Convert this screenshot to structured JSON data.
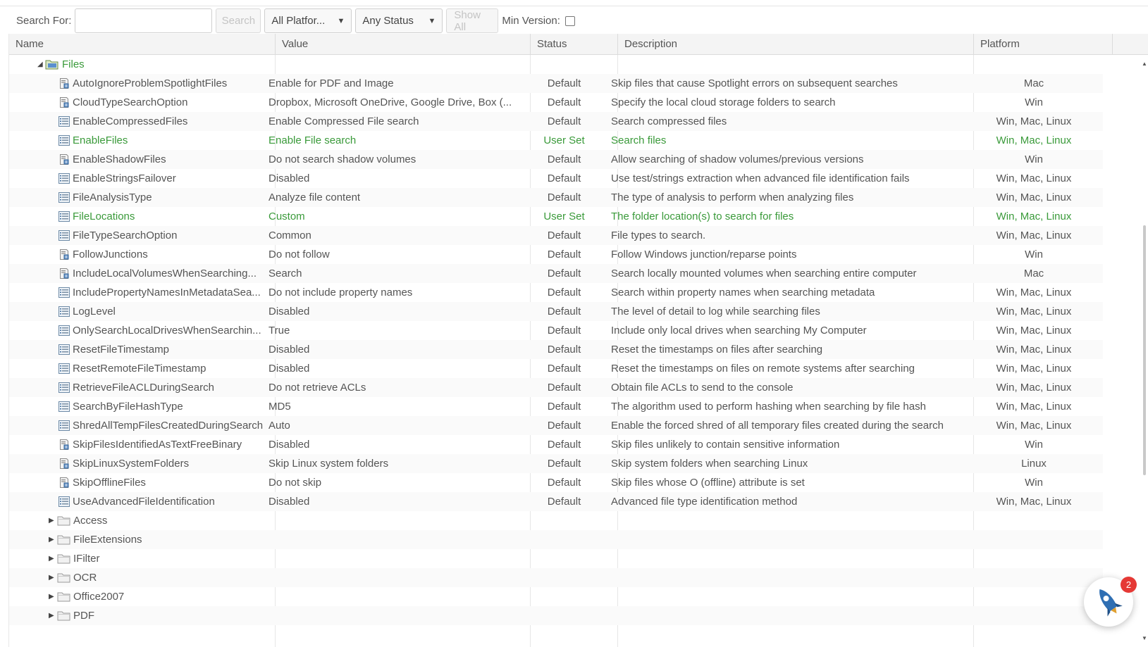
{
  "toolbar": {
    "search_label": "Search For:",
    "search_value": "",
    "search_button": "Search",
    "platform_select": "All Platfor...",
    "status_select": "Any Status",
    "show_all_button": "Show All",
    "min_version_label": "Min Version:"
  },
  "columns": [
    "Name",
    "Value",
    "Status",
    "Description",
    "Platform"
  ],
  "root_folder": "Files",
  "rows": [
    {
      "name": "AutoIgnoreProblemSpotlightFiles",
      "value": "Enable for PDF and Image",
      "status": "Default",
      "description": "Skip files that cause Spotlight errors on subsequent searches",
      "platform": "Mac",
      "icon": "setting-script-icon"
    },
    {
      "name": "CloudTypeSearchOption",
      "value": "Dropbox, Microsoft OneDrive, Google Drive, Box (...",
      "status": "Default",
      "description": "Specify the local cloud storage folders to search",
      "platform": "Win",
      "icon": "setting-script-icon"
    },
    {
      "name": "EnableCompressedFiles",
      "value": "Enable Compressed File search",
      "status": "Default",
      "description": "Search compressed files",
      "platform": "Win, Mac, Linux",
      "icon": "setting-list-icon"
    },
    {
      "name": "EnableFiles",
      "value": "Enable File search",
      "status": "User Set",
      "description": "Search files",
      "platform": "Win, Mac, Linux",
      "icon": "setting-list-icon",
      "user_set": true
    },
    {
      "name": "EnableShadowFiles",
      "value": "Do not search shadow volumes",
      "status": "Default",
      "description": "Allow searching of shadow volumes/previous versions",
      "platform": "Win",
      "icon": "setting-script-icon"
    },
    {
      "name": "EnableStringsFailover",
      "value": "Disabled",
      "status": "Default",
      "description": "Use test/strings extraction when advanced file identification fails",
      "platform": "Win, Mac, Linux",
      "icon": "setting-list-icon"
    },
    {
      "name": "FileAnalysisType",
      "value": "Analyze file content",
      "status": "Default",
      "description": "The type of analysis to perform when analyzing files",
      "platform": "Win, Mac, Linux",
      "icon": "setting-list-icon"
    },
    {
      "name": "FileLocations",
      "value": "Custom",
      "status": "User Set",
      "description": "The folder location(s) to search for files",
      "platform": "Win, Mac, Linux",
      "icon": "setting-list-icon",
      "user_set": true
    },
    {
      "name": "FileTypeSearchOption",
      "value": "Common",
      "status": "Default",
      "description": "File types to search.",
      "platform": "Win, Mac, Linux",
      "icon": "setting-list-icon"
    },
    {
      "name": "FollowJunctions",
      "value": "Do not follow",
      "status": "Default",
      "description": "Follow Windows junction/reparse points",
      "platform": "Win",
      "icon": "setting-script-icon"
    },
    {
      "name": "IncludeLocalVolumesWhenSearching...",
      "value": "Search",
      "status": "Default",
      "description": "Search locally mounted volumes when searching entire computer",
      "platform": "Mac",
      "icon": "setting-script-icon"
    },
    {
      "name": "IncludePropertyNamesInMetadataSea...",
      "value": "Do not include property names",
      "status": "Default",
      "description": "Search within property names when searching metadata",
      "platform": "Win, Mac, Linux",
      "icon": "setting-list-icon"
    },
    {
      "name": "LogLevel",
      "value": "Disabled",
      "status": "Default",
      "description": "The level of detail to log while searching files",
      "platform": "Win, Mac, Linux",
      "icon": "setting-list-icon"
    },
    {
      "name": "OnlySearchLocalDrivesWhenSearchin...",
      "value": "True",
      "status": "Default",
      "description": "Include only local drives when searching My Computer",
      "platform": "Win, Mac, Linux",
      "icon": "setting-list-icon"
    },
    {
      "name": "ResetFileTimestamp",
      "value": "Disabled",
      "status": "Default",
      "description": "Reset the timestamps on files after searching",
      "platform": "Win, Mac, Linux",
      "icon": "setting-list-icon"
    },
    {
      "name": "ResetRemoteFileTimestamp",
      "value": "Disabled",
      "status": "Default",
      "description": "Reset the timestamps on files on remote systems after searching",
      "platform": "Win, Mac, Linux",
      "icon": "setting-list-icon"
    },
    {
      "name": "RetrieveFileACLDuringSearch",
      "value": "Do not retrieve ACLs",
      "status": "Default",
      "description": "Obtain file ACLs to send to the console",
      "platform": "Win, Mac, Linux",
      "icon": "setting-list-icon"
    },
    {
      "name": "SearchByFileHashType",
      "value": "MD5",
      "status": "Default",
      "description": "The algorithm used to perform hashing when searching by file hash",
      "platform": "Win, Mac, Linux",
      "icon": "setting-list-icon"
    },
    {
      "name": "ShredAllTempFilesCreatedDuringSearch",
      "value": "Auto",
      "status": "Default",
      "description": "Enable the forced shred of all temporary files created during the search",
      "platform": "Win, Mac, Linux",
      "icon": "setting-list-icon"
    },
    {
      "name": "SkipFilesIdentifiedAsTextFreeBinary",
      "value": "Disabled",
      "status": "Default",
      "description": "Skip files unlikely to contain sensitive information",
      "platform": "Win",
      "icon": "setting-script-icon"
    },
    {
      "name": "SkipLinuxSystemFolders",
      "value": "Skip Linux system folders",
      "status": "Default",
      "description": "Skip system folders when searching Linux",
      "platform": "Linux",
      "icon": "setting-script-icon"
    },
    {
      "name": "SkipOfflineFiles",
      "value": "Do not skip",
      "status": "Default",
      "description": "Skip files whose O (offline) attribute is set",
      "platform": "Win",
      "icon": "setting-script-icon"
    },
    {
      "name": "UseAdvancedFileIdentification",
      "value": "Disabled",
      "status": "Default",
      "description": "Advanced file type identification method",
      "platform": "Win, Mac, Linux",
      "icon": "setting-list-icon"
    }
  ],
  "subfolders": [
    "Access",
    "FileExtensions",
    "IFilter",
    "OCR",
    "Office2007",
    "PDF"
  ],
  "helper_badge": "2",
  "colors": {
    "user_set_green": "#3a9a3a",
    "badge_red": "#e53935"
  }
}
